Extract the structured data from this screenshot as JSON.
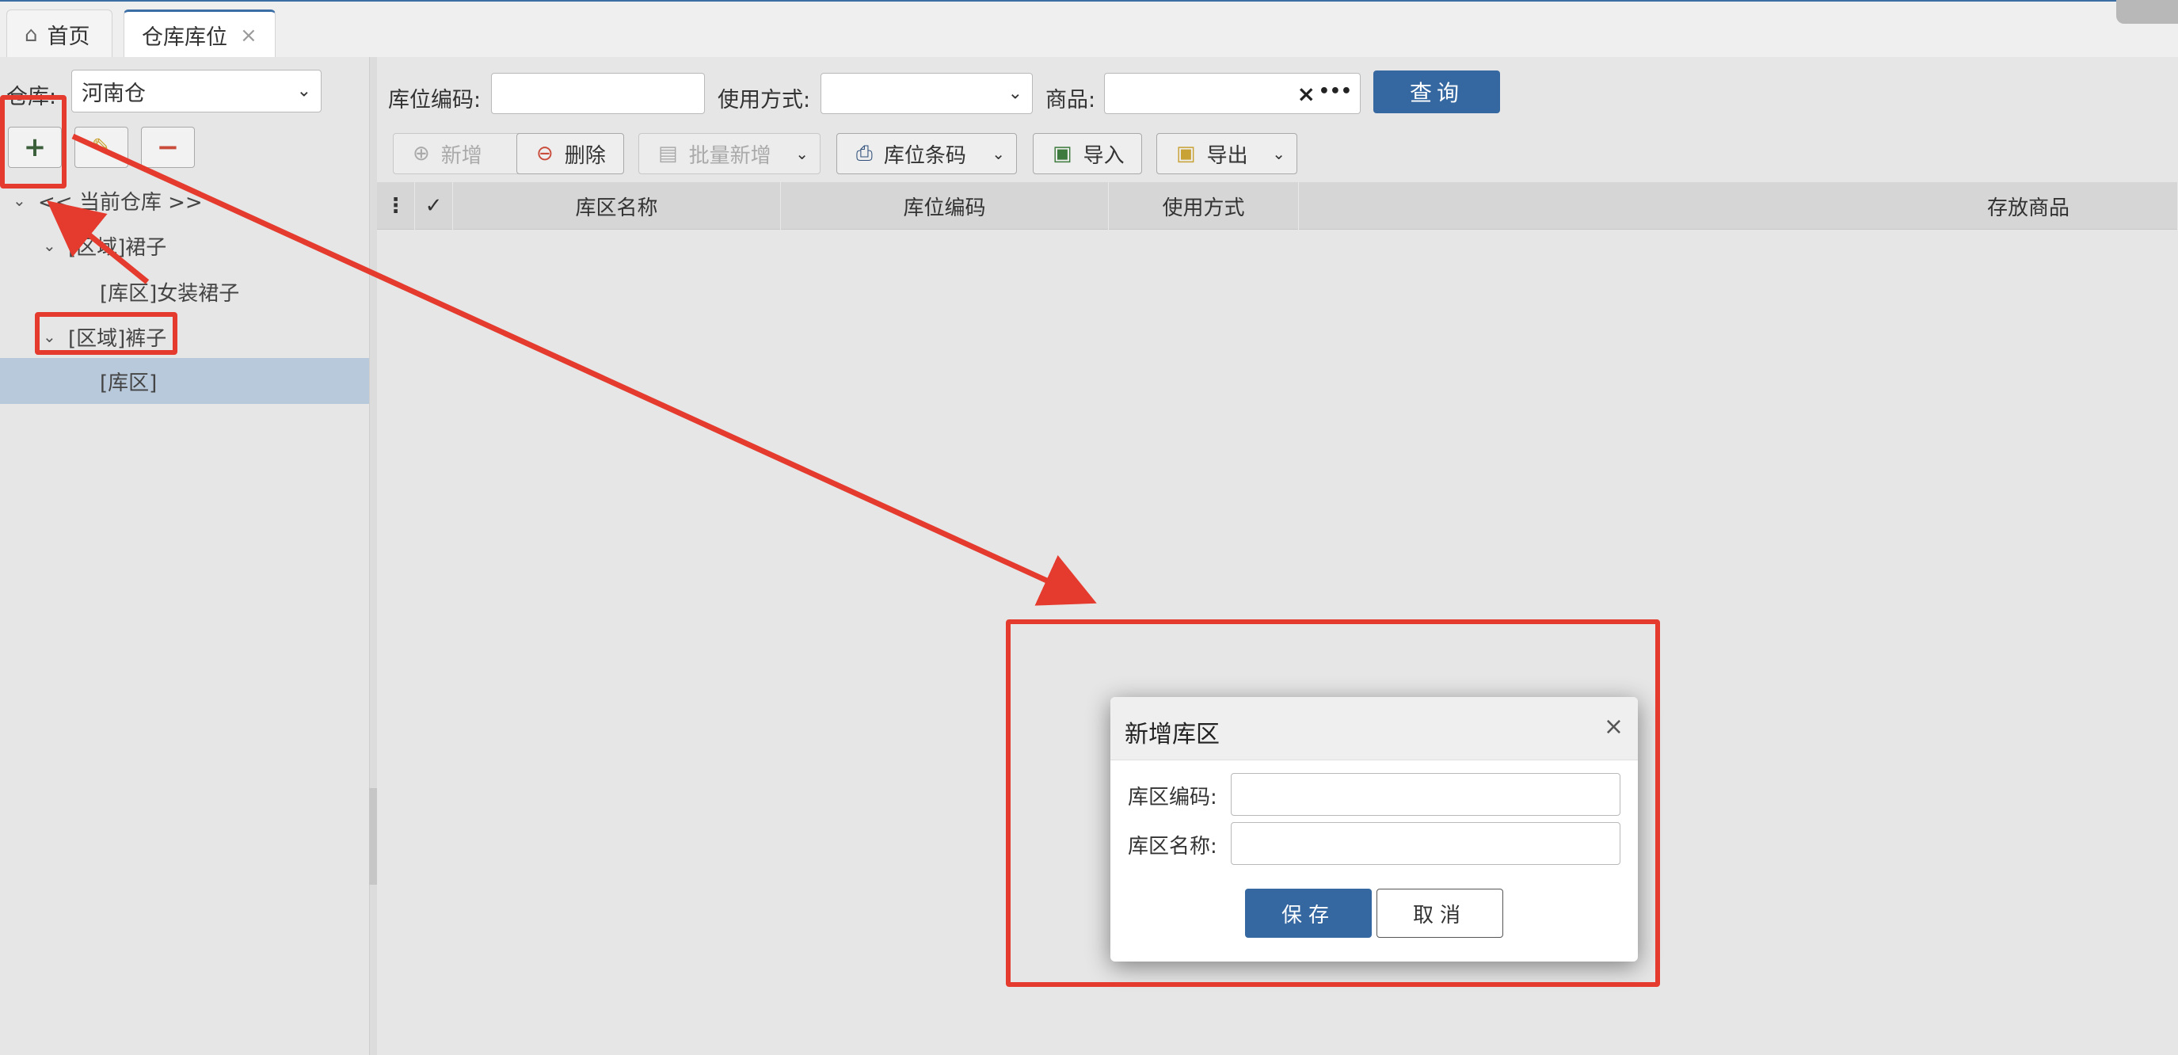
{
  "tabs": [
    {
      "label": "首页",
      "icon": "home-icon"
    },
    {
      "label": "仓库库位",
      "icon": "",
      "closable": true
    }
  ],
  "left": {
    "warehouse_label": "仓库:",
    "warehouse_value": "河南仓",
    "tools": [
      {
        "name": "add",
        "glyph": "+"
      },
      {
        "name": "edit",
        "glyph": "✎"
      },
      {
        "name": "remove",
        "glyph": "−"
      }
    ],
    "tree": [
      {
        "label": "<< 当前仓库 >>",
        "level": 0,
        "expanded": true
      },
      {
        "label": "[区域]裙子",
        "level": 1,
        "expanded": true
      },
      {
        "label": "[库区]女装裙子",
        "level": 2
      },
      {
        "label": "[区域]裤子",
        "level": 1,
        "expanded": true
      },
      {
        "label": "[库区]",
        "level": 2,
        "selected": true
      }
    ]
  },
  "filters": {
    "location_code_label": "库位编码:",
    "usage_label": "使用方式:",
    "goods_label": "商品:",
    "goods_clear": "×",
    "goods_more": "•••",
    "query_label": "查询"
  },
  "toolbar": [
    {
      "label": "新增",
      "icon": "add-circle-icon",
      "disabled": true
    },
    {
      "label": "删除",
      "icon": "minus-circle-icon"
    },
    {
      "label": "批量新增",
      "icon": "document-icon",
      "disabled": true,
      "dropdown": true
    },
    {
      "label": "库位条码",
      "icon": "printer-icon",
      "dropdown": true
    },
    {
      "label": "导入",
      "icon": "excel-icon"
    },
    {
      "label": "导出",
      "icon": "excel-icon",
      "dropdown": true
    }
  ],
  "grid": {
    "columns": [
      "库区名称",
      "库位编码",
      "使用方式",
      "存放商品"
    ]
  },
  "dialog": {
    "title": "新增库区",
    "close": "×",
    "code_label": "库区编码:",
    "name_label": "库区名称:",
    "save_label": "保存",
    "cancel_label": "取消"
  },
  "colors": {
    "accent": "#3567a0",
    "annotation": "#e53b2e",
    "selected_row": "#b8c9dc"
  }
}
